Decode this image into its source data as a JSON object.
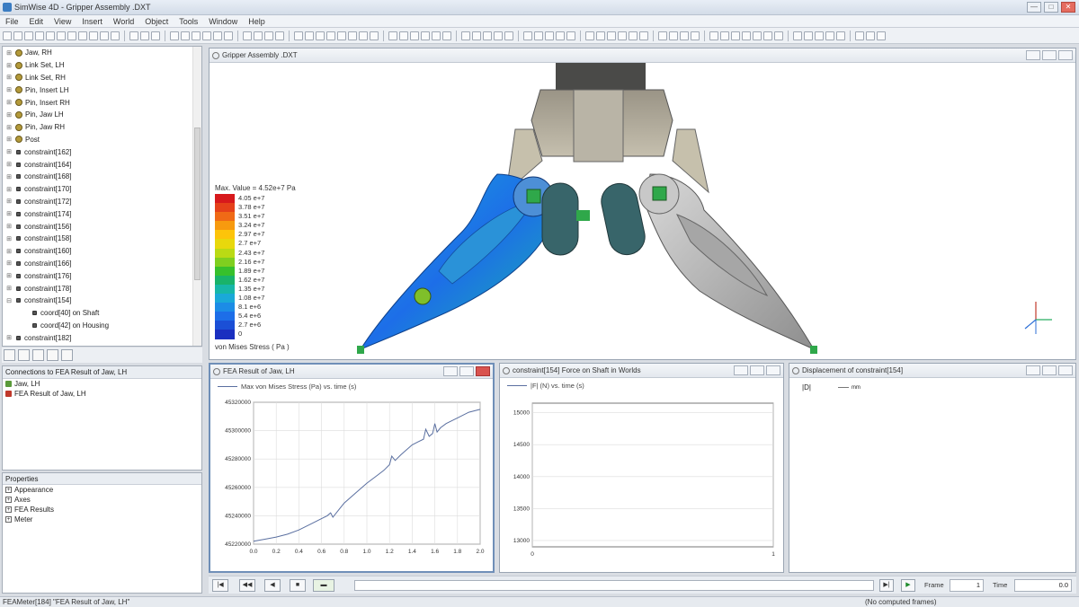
{
  "window": {
    "title": "SimWise 4D - Gripper Assembly .DXT",
    "minimize": "—",
    "maximize": "□",
    "close": "✕"
  },
  "menu": [
    "File",
    "Edit",
    "View",
    "Insert",
    "World",
    "Object",
    "Tools",
    "Window",
    "Help"
  ],
  "tree": {
    "items": [
      {
        "label": "Jaw, RH",
        "kind": "part"
      },
      {
        "label": "Link Set, LH",
        "kind": "part"
      },
      {
        "label": "Link Set, RH",
        "kind": "part"
      },
      {
        "label": "Pin, Insert LH",
        "kind": "part"
      },
      {
        "label": "Pin, Insert RH",
        "kind": "part"
      },
      {
        "label": "Pin, Jaw LH",
        "kind": "part"
      },
      {
        "label": "Pin, Jaw RH",
        "kind": "part"
      },
      {
        "label": "Post",
        "kind": "part"
      },
      {
        "label": "constraint[162]",
        "kind": "constraint"
      },
      {
        "label": "constraint[164]",
        "kind": "constraint"
      },
      {
        "label": "constraint[168]",
        "kind": "constraint"
      },
      {
        "label": "constraint[170]",
        "kind": "constraint"
      },
      {
        "label": "constraint[172]",
        "kind": "constraint"
      },
      {
        "label": "constraint[174]",
        "kind": "constraint"
      },
      {
        "label": "constraint[156]",
        "kind": "constraint"
      },
      {
        "label": "constraint[158]",
        "kind": "constraint"
      },
      {
        "label": "constraint[160]",
        "kind": "constraint"
      },
      {
        "label": "constraint[166]",
        "kind": "constraint"
      },
      {
        "label": "constraint[176]",
        "kind": "constraint"
      },
      {
        "label": "constraint[178]",
        "kind": "constraint"
      },
      {
        "label": "constraint[154]",
        "kind": "constraint"
      },
      {
        "label": "coord[40] on Shaft",
        "kind": "coord"
      },
      {
        "label": "coord[42] on Housing",
        "kind": "coord"
      },
      {
        "label": "constraint[182]",
        "kind": "constraint"
      }
    ]
  },
  "connections": {
    "title": "Connections to FEA Result of Jaw, LH",
    "rows": [
      "Jaw, LH",
      "FEA Result of Jaw, LH"
    ]
  },
  "properties": {
    "title": "Properties",
    "rows": [
      "Appearance",
      "Axes",
      "FEA Results",
      "Meter"
    ]
  },
  "view3d": {
    "title": "Gripper Assembly .DXT",
    "legend_title": "Max. Value = 4.52e+7 Pa",
    "legend_values": [
      "4.05 e+7",
      "3.78 e+7",
      "3.51 e+7",
      "3.24 e+7",
      "2.97 e+7",
      "2.7 e+7",
      "2.43 e+7",
      "2.16 e+7",
      "1.89 e+7",
      "1.62 e+7",
      "1.35 e+7",
      "1.08 e+7",
      "8.1 e+6",
      "5.4 e+6",
      "2.7 e+6",
      "0"
    ],
    "legend_colors": [
      "#d7191c",
      "#e5411a",
      "#f06a16",
      "#f79a0f",
      "#fdc40a",
      "#e8d80c",
      "#bada14",
      "#7fcf1f",
      "#37c02c",
      "#19b36a",
      "#17b7a8",
      "#1aa9d8",
      "#1c8ce6",
      "#1d6ee8",
      "#1b4fd6",
      "#1a2fc0"
    ],
    "legend_label": "von Mises  Stress  ( Pa )"
  },
  "plot1": {
    "title": "FEA Result of Jaw, LH",
    "legend": "Max von Mises  Stress (Pa)  vs.  time (s)"
  },
  "plot2": {
    "title": "constraint[154] Force on Shaft in Worlds",
    "legend": "|F| (N)  vs.  time (s)"
  },
  "plot3": {
    "title": "Displacement of constraint[154]",
    "legend_label": "|D|",
    "legend_unit": "mm"
  },
  "chart_data": [
    {
      "type": "line",
      "title": "FEA Result of Jaw, LH",
      "series": [
        {
          "name": "Max von Mises  Stress (Pa)  vs.  time (s)",
          "x": [
            0,
            0.1,
            0.2,
            0.3,
            0.4,
            0.5,
            0.6,
            0.65,
            0.68,
            0.7,
            0.75,
            0.8,
            0.9,
            1.0,
            1.1,
            1.15,
            1.2,
            1.22,
            1.25,
            1.3,
            1.4,
            1.45,
            1.5,
            1.52,
            1.55,
            1.58,
            1.6,
            1.62,
            1.65,
            1.7,
            1.8,
            1.9,
            2.0
          ],
          "y": [
            45222000,
            45223500,
            45225000,
            45227000,
            45230000,
            45234000,
            45238000,
            45240000,
            45242000,
            45239000,
            45244000,
            45249000,
            45256000,
            45263000,
            45269000,
            45272000,
            45276000,
            45282000,
            45279000,
            45283000,
            45290000,
            45292000,
            45294000,
            45301000,
            45296000,
            45298000,
            45305000,
            45299000,
            45302000,
            45305000,
            45309000,
            45313000,
            45315000
          ]
        }
      ],
      "xlim": [
        0,
        2.0
      ],
      "ylim": [
        45220000,
        45320000
      ],
      "xticks": [
        "0.0",
        "0.2",
        "0.4",
        "0.6",
        "0.8",
        "1.0",
        "1.2",
        "1.4",
        "1.6",
        "1.8",
        "2.0"
      ],
      "yticks": [
        "45220000",
        "45240000",
        "45260000",
        "45280000",
        "45300000",
        "45320000"
      ]
    },
    {
      "type": "line",
      "title": "constraint[154] Force on Shaft in Worlds",
      "series": [
        {
          "name": "|F| (N)  vs.  time (s)",
          "x": [],
          "y": []
        }
      ],
      "xlim": [
        0,
        1
      ],
      "ylim": [
        12900,
        15150
      ],
      "xticks": [
        "0",
        "1"
      ],
      "yticks": [
        "13000",
        "13500",
        "14000",
        "14500",
        "15000"
      ]
    }
  ],
  "playbar": {
    "frame_label": "Frame",
    "frame_value": "1",
    "time_label": "Time",
    "time_value": "0.0"
  },
  "status": {
    "left": "FEAMeter[184] \"FEA Result of Jaw, LH\"",
    "right": "(No computed frames)"
  }
}
